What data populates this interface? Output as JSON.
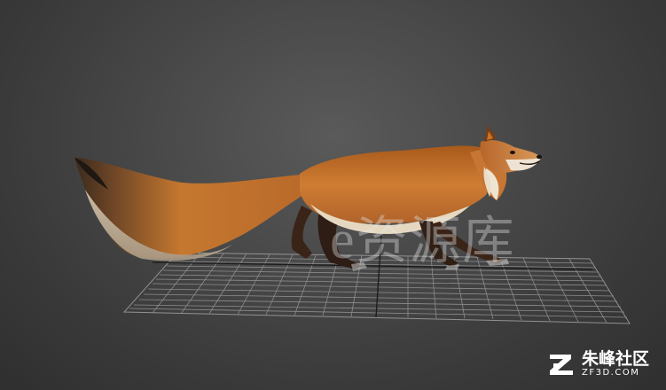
{
  "scene": {
    "background_color": "#474747",
    "subject": "fox-model",
    "fox_colors": {
      "fur_main": "#c8752a",
      "fur_dark": "#7a3c12",
      "fur_light": "#e9ddc8",
      "legs": "#3a2418"
    }
  },
  "watermark": {
    "latin": "e",
    "chinese": "资源库"
  },
  "brand": {
    "name": "朱峰社区",
    "domain": "ZF3D.COM"
  }
}
